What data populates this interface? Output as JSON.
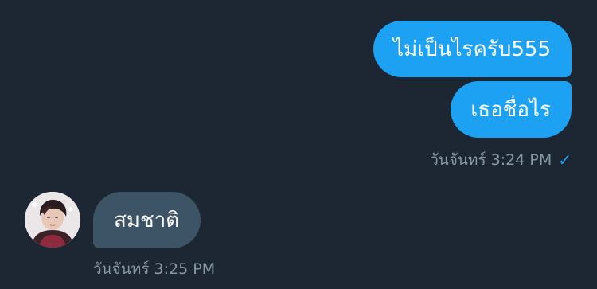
{
  "messages": {
    "outgoing": [
      {
        "text": "ไม่เป็นไรครับ555"
      },
      {
        "text": "เธอชื่อไร"
      }
    ],
    "outgoing_time": "วันจันทร์ 3:24 PM",
    "outgoing_check": "✓",
    "incoming": [
      {
        "text": "สมชาติ"
      }
    ],
    "incoming_time": "วันจันทร์ 3:25 PM"
  },
  "colors": {
    "background": "#1c2733",
    "outgoing_bubble": "#1da1f2",
    "incoming_bubble": "#3d5466",
    "meta_text": "#8899a6"
  },
  "icons": {
    "read_receipt": "checkmark-icon",
    "sender_avatar": "avatar"
  }
}
